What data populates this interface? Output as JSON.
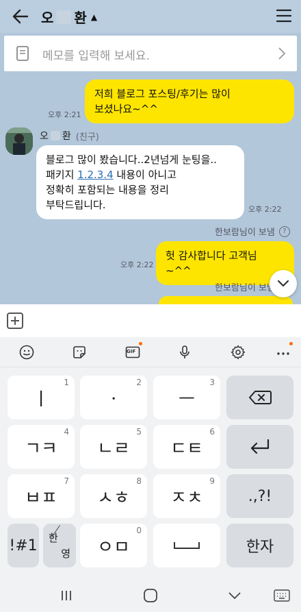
{
  "header": {
    "contact_name_first": "오",
    "contact_name_last": "환",
    "caret": "▲"
  },
  "memo": {
    "placeholder": "메모를 입력해 보세요."
  },
  "messages": {
    "out1_line1": "저희 블로그 포스팅/후기는 많이",
    "out1_line2": "보셨나요~^^",
    "out1_time": "오후 2:21",
    "in_sender_first": "오",
    "in_sender_last": "환",
    "in_sender_tag": "(친구)",
    "in_line1": "블로그 많이 봤습니다..2년넘게 눈팅을..",
    "in_line2_pre": "패키지 ",
    "in_line2_link": "1.2.3.4",
    "in_line2_post": " 내용이 아니고",
    "in_line3": "정확히 포함되는 내용을 정리",
    "in_line4": "부탁드립니다.",
    "in_time": "오후 2:22",
    "readby1": "한보람님이 보냄",
    "out2_text": "헛 감사합니다 고객님 ~^^",
    "out2_time": "오후 2:22",
    "readby2": "한보람님이 보냄"
  },
  "keyboard": {
    "keys": {
      "k1": "ㅣ",
      "n1": "1",
      "k2": "ㆍ",
      "n2": "2",
      "k3": "ㅡ",
      "n3": "3",
      "k4": "ㄱㅋ",
      "n4": "4",
      "k5": "ㄴㄹ",
      "n5": "5",
      "k6": "ㄷㅌ",
      "n6": "6",
      "k7": "ㅂㅍ",
      "n7": "7",
      "k8": "ㅅㅎ",
      "n8": "8",
      "k9": "ㅈㅊ",
      "n9": "9",
      "k0": "ㅇㅁ",
      "n0": "0",
      "punct": ".,?!",
      "symbols": "!#1",
      "han_top": "한",
      "han_bot": "영",
      "hanja": "한자"
    },
    "gif_label": "GIF",
    "accent_dot_color": "#ff6a00"
  }
}
